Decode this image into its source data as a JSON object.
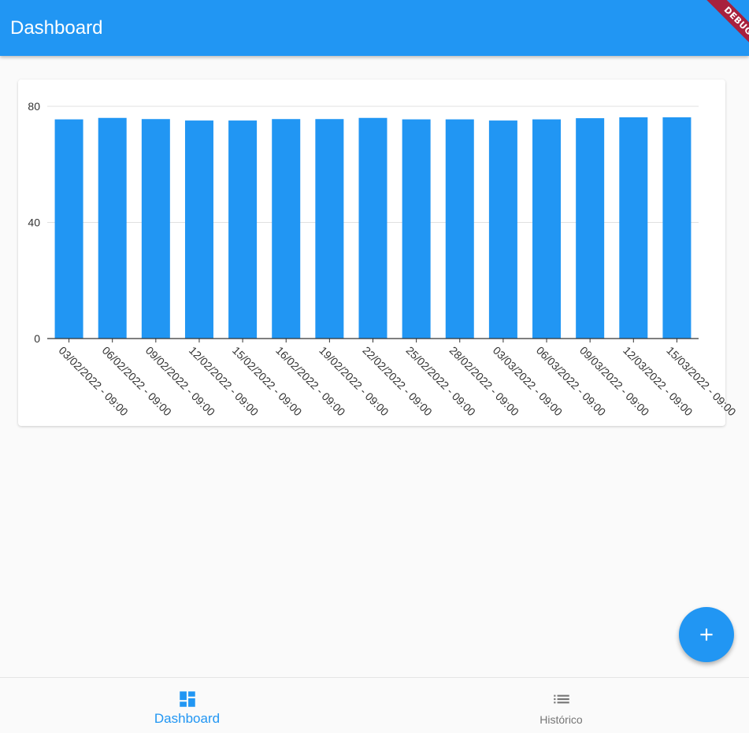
{
  "app_bar": {
    "title": "Dashboard",
    "debug_banner": "DEBUG"
  },
  "colors": {
    "primary": "#2196f3",
    "debug": "#a8213d",
    "inactive": "#757575"
  },
  "chart_data": {
    "type": "bar",
    "categories": [
      "03/02/2022 - 09:00",
      "06/02/2022 - 09:00",
      "09/02/2022 - 09:00",
      "12/02/2022 - 09:00",
      "15/02/2022 - 09:00",
      "16/02/2022 - 09:00",
      "19/02/2022 - 09:00",
      "22/02/2022 - 09:00",
      "25/02/2022 - 09:00",
      "28/02/2022 - 09:00",
      "03/03/2022 - 09:00",
      "06/03/2022 - 09:00",
      "09/03/2022 - 09:00",
      "12/03/2022 - 09:00",
      "15/03/2022 - 09:00"
    ],
    "values": [
      75.5,
      76.0,
      75.6,
      75.1,
      75.1,
      75.6,
      75.6,
      76.0,
      75.5,
      75.5,
      75.1,
      75.5,
      75.9,
      76.2,
      76.2
    ],
    "ylim": [
      0,
      80
    ],
    "yticks": [
      "0",
      "40",
      "80"
    ],
    "title": "",
    "xlabel": "",
    "ylabel": "",
    "grid": true,
    "bar_color": "#2196f3"
  },
  "fab": {
    "icon": "add-icon"
  },
  "bottom_nav": {
    "items": [
      {
        "label": "Dashboard",
        "icon": "dashboard-icon",
        "active": true
      },
      {
        "label": "Histórico",
        "icon": "list-icon",
        "active": false
      }
    ]
  }
}
